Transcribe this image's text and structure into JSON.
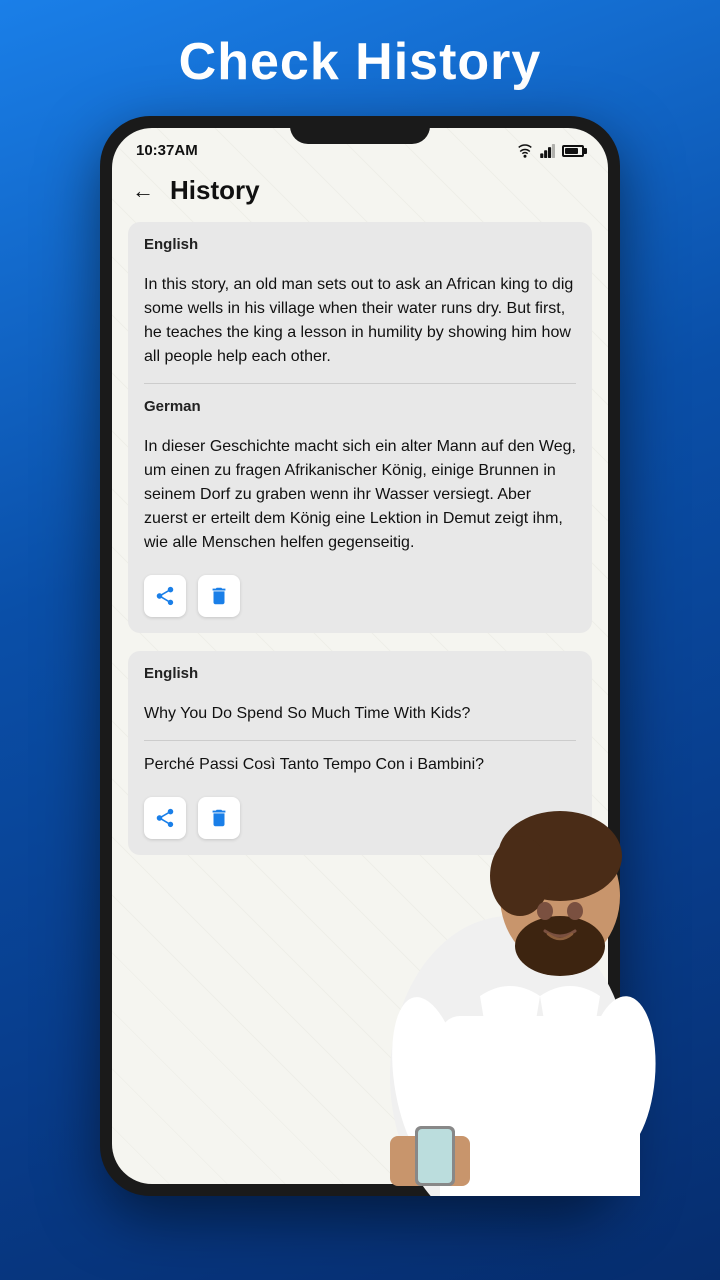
{
  "header": {
    "title": "Check History",
    "color": "#ffffff"
  },
  "statusBar": {
    "time": "10:37AM",
    "wifi": "wifi",
    "signal": "signal",
    "battery": "battery"
  },
  "appHeader": {
    "backIcon": "←",
    "title": "History"
  },
  "historyCards": [
    {
      "id": "card-1",
      "sourceLang": "English",
      "sourceText": "In this story, an old man sets out to ask an African king to dig some wells in his village when their water runs dry. But first, he teaches the king a lesson in humility by showing him how all people help each other.",
      "targetLang": "German",
      "targetText": "In dieser Geschichte macht sich ein alter Mann auf den Weg, um einen zu fragen Afrikanischer König, einige Brunnen in seinem Dorf zu graben wenn ihr Wasser versiegt. Aber zuerst er erteilt dem König eine Lektion in Demut zeigt ihm, wie alle Menschen helfen gegenseitig.",
      "hasActions": true
    },
    {
      "id": "card-2",
      "sourceLang": "English",
      "sourceText": "Why You Do Spend So Much Time With Kids?",
      "targetLang": "",
      "targetText": "Perché Passi Così Tanto Tempo Con i Bambini?",
      "hasActions": true
    }
  ],
  "actions": {
    "shareLabel": "share",
    "deleteLabel": "delete"
  }
}
